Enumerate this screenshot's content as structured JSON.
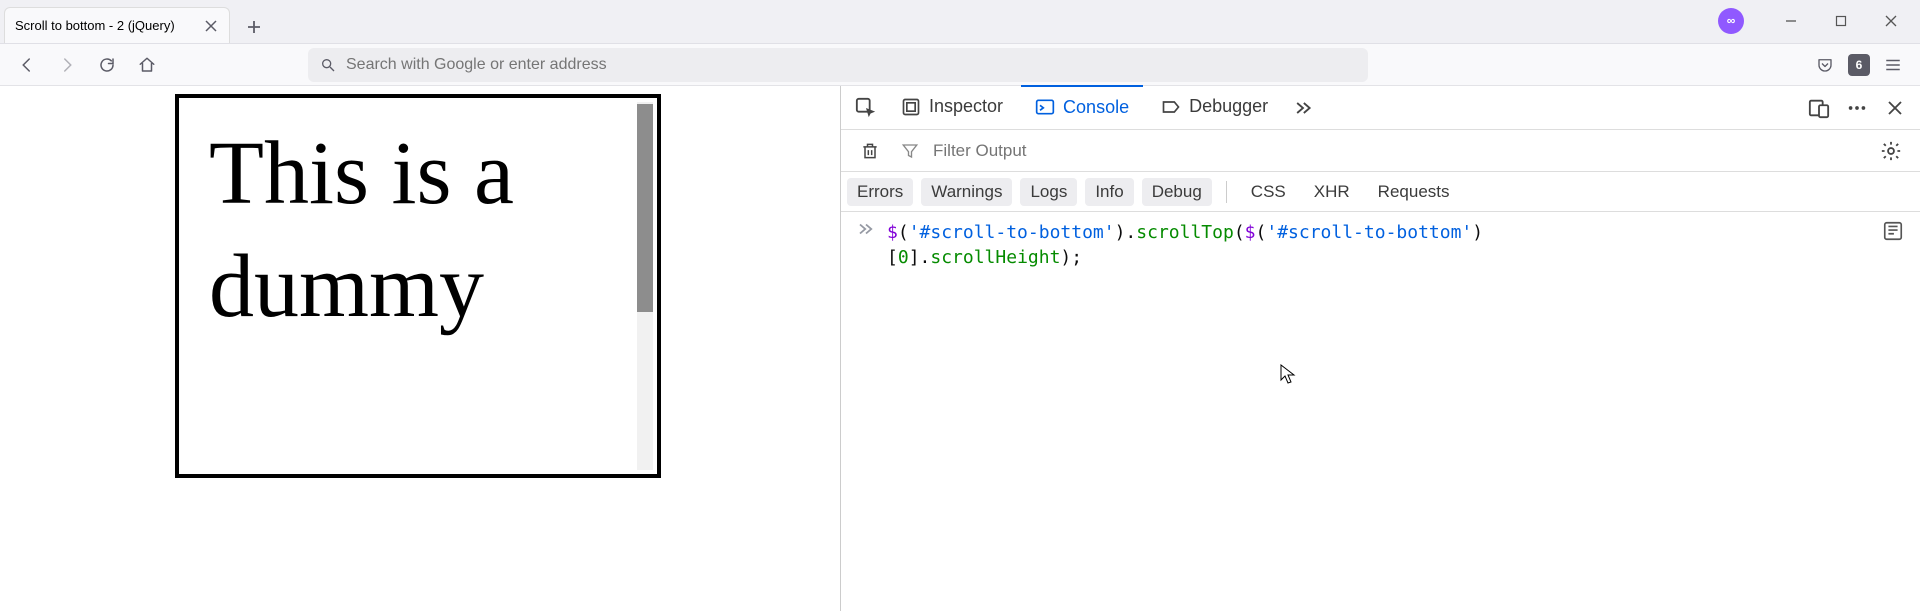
{
  "browser_tab": {
    "title": "Scroll to bottom - 2 (jQuery)"
  },
  "addressbar": {
    "placeholder": "Search with Google or enter address"
  },
  "toolbar_counter": "6",
  "page": {
    "scroll_box_text": "This is a dummy"
  },
  "devtools": {
    "tabs": {
      "inspector": "Inspector",
      "console": "Console",
      "debugger": "Debugger"
    },
    "filter_placeholder": "Filter Output",
    "categories": {
      "errors": "Errors",
      "warnings": "Warnings",
      "logs": "Logs",
      "info": "Info",
      "debug": "Debug",
      "css": "CSS",
      "xhr": "XHR",
      "requests": "Requests"
    },
    "console_input": {
      "tokens": [
        {
          "t": "fn",
          "v": "$"
        },
        {
          "t": "default",
          "v": "("
        },
        {
          "t": "str",
          "v": "'#scroll-to-bottom'"
        },
        {
          "t": "default",
          "v": ")."
        },
        {
          "t": "prop",
          "v": "scrollTop"
        },
        {
          "t": "default",
          "v": "("
        },
        {
          "t": "fn",
          "v": "$"
        },
        {
          "t": "default",
          "v": "("
        },
        {
          "t": "str",
          "v": "'#scroll-to-bottom'"
        },
        {
          "t": "default",
          "v": ")\n["
        },
        {
          "t": "num",
          "v": "0"
        },
        {
          "t": "default",
          "v": "]."
        },
        {
          "t": "prop",
          "v": "scrollHeight"
        },
        {
          "t": "default",
          "v": ");"
        }
      ]
    }
  }
}
